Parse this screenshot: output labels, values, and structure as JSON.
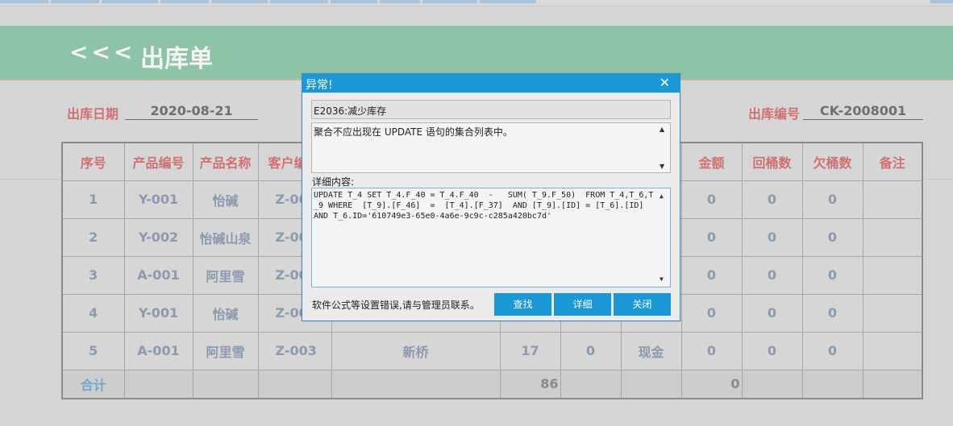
{
  "header": {
    "back_label": "<<<",
    "title": "出库单"
  },
  "form": {
    "date_label": "出库日期",
    "date_value": "2020-08-21",
    "number_label": "出库编号",
    "number_value": "CK-2008001"
  },
  "table": {
    "columns": [
      "序号",
      "产品编号",
      "产品名称",
      "客户编",
      "",
      "",
      "",
      "",
      "金额",
      "回桶数",
      "欠桶数",
      "备注"
    ],
    "rows": [
      [
        "1",
        "Y-001",
        "怡碱",
        "Z-00",
        "",
        "",
        "",
        "",
        "0",
        "0",
        "0",
        ""
      ],
      [
        "2",
        "Y-002",
        "怡碱山泉",
        "Z-00",
        "",
        "",
        "",
        "",
        "0",
        "0",
        "0",
        ""
      ],
      [
        "3",
        "A-001",
        "阿里雪",
        "Z-00",
        "",
        "",
        "",
        "",
        "0",
        "0",
        "0",
        ""
      ],
      [
        "4",
        "Y-001",
        "怡碱",
        "Z-00",
        "",
        "",
        "",
        "",
        "0",
        "0",
        "0",
        ""
      ],
      [
        "5",
        "A-001",
        "阿里雪",
        "Z-003",
        "新桥",
        "17",
        "0",
        "现金",
        "0",
        "0",
        "0",
        ""
      ]
    ],
    "summary": [
      "合计",
      "",
      "",
      "",
      "",
      "86",
      "",
      "",
      "0",
      "",
      "",
      ""
    ]
  },
  "dialog": {
    "title": "异常!",
    "close_glyph": "✕",
    "code": "E2036:减少库存",
    "message": "聚合不应出现在 UPDATE 语句的集合列表中。",
    "detail_label": "详细内容:",
    "detail": "UPDATE T_4 SET T_4.F_40 = T_4.F_40  -   SUM( T_9.F_50)  FROM T_4,T_6,T_9 WHERE  [T_9].[F_46]  =  [T_4].[F_37]  AND [T_9].[ID] = [T_6].[ID]  AND T_6.ID='610749e3-65e0-4a6e-9c9c-c285a420bc7d'",
    "footer": "软件公式等设置错误,请与管理员联系。",
    "buttons": {
      "find": "查找",
      "detail": "详细",
      "close": "关闭"
    }
  },
  "colors": {
    "header_bg": "#8dc4a6",
    "label_red": "#d07070",
    "cell_text": "#8c9aaf",
    "dialog_accent": "#1a99d6"
  }
}
